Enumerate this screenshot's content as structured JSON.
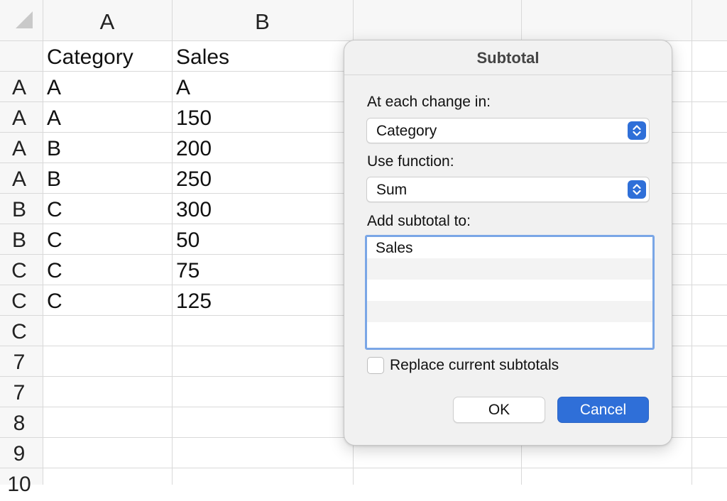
{
  "sheet": {
    "columns": [
      "A",
      "B"
    ],
    "header_row": [
      "Category",
      "Sales"
    ],
    "row_headers": [
      "A",
      "A",
      "A",
      "A",
      "B",
      "B",
      "C",
      "C",
      "C",
      "7",
      "7",
      "8",
      "9",
      "10"
    ],
    "rows": [
      [
        "A",
        "A"
      ],
      [
        "A",
        "150"
      ],
      [
        "B",
        "200"
      ],
      [
        "B",
        "250"
      ],
      [
        "C",
        "300"
      ],
      [
        "C",
        "50"
      ],
      [
        "C",
        "75"
      ],
      [
        "C",
        "125"
      ]
    ]
  },
  "dialog": {
    "title": "Subtotal",
    "change_label": "At each change in:",
    "change_value": "Category",
    "function_label": "Use function:",
    "function_value": "Sum",
    "add_label": "Add subtotal to:",
    "add_items": [
      "Sales"
    ],
    "replace_label": "Replace current subtotals",
    "replace_checked": false,
    "ok_label": "OK",
    "cancel_label": "Cancel",
    "accent_color": "#2f6fd8"
  },
  "icons": {
    "corner": "select-all-triangle-icon",
    "stepper": "up-down-chevron-icon"
  }
}
